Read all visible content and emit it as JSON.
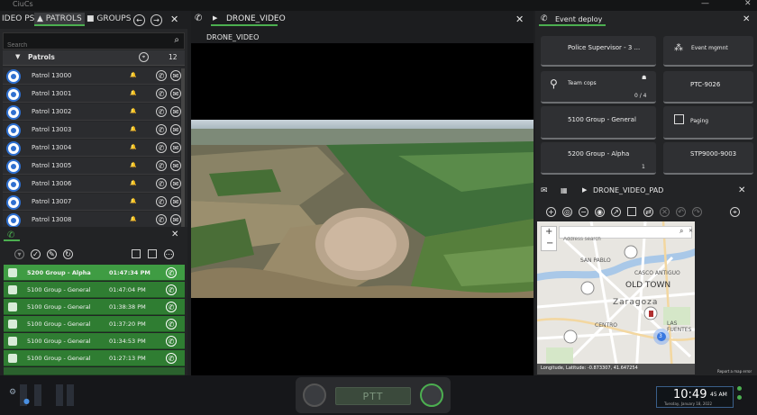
{
  "title_bar": {
    "app_name": "CiuCs"
  },
  "left_panel": {
    "tabs": [
      {
        "label": "IDEO PS"
      },
      {
        "label": "PATROLS"
      },
      {
        "label": "GROUPS"
      }
    ],
    "search_placeholder": "Search",
    "group": {
      "name": "Patrols",
      "count": "12"
    },
    "patrols": [
      {
        "name": "Patrol 13000"
      },
      {
        "name": "Patrol 13001"
      },
      {
        "name": "Patrol 13002"
      },
      {
        "name": "Patrol 13003"
      },
      {
        "name": "Patrol 13004"
      },
      {
        "name": "Patrol 13005"
      },
      {
        "name": "Patrol 13006"
      },
      {
        "name": "Patrol 13007"
      },
      {
        "name": "Patrol 13008"
      }
    ]
  },
  "call_history": {
    "rows": [
      {
        "group": "5200 Group - Alpha",
        "time": "01:47:34 PM"
      },
      {
        "group": "5100 Group - General",
        "time": "01:47:04 PM"
      },
      {
        "group": "5100 Group - General",
        "time": "01:38:38 PM"
      },
      {
        "group": "5100 Group - General",
        "time": "01:37:20 PM"
      },
      {
        "group": "5100 Group - General",
        "time": "01:34:53 PM"
      },
      {
        "group": "5100 Group - General",
        "time": "01:27:13 PM"
      }
    ]
  },
  "center": {
    "tab_label": "DRONE_VIDEO",
    "video_title": "DRONE_VIDEO"
  },
  "right_panel": {
    "title": "Event deploy",
    "cards": [
      {
        "label": "Police Supervisor - 3 ..."
      },
      {
        "label": "Event mgmnt"
      },
      {
        "label": "Team cops",
        "count": "0 / 4"
      },
      {
        "label": "PTC-9026"
      },
      {
        "label": "5100 Group - General"
      },
      {
        "label": "Paging"
      },
      {
        "label": "5200 Group - Alpha",
        "count": "1"
      },
      {
        "label": "STP9000-9003"
      }
    ],
    "map_tab_label": "DRONE_VIDEO_PAD",
    "map": {
      "search_placeholder": "Address search",
      "labels": [
        "SAN PABLO",
        "CASCO ANTIGUO",
        "OLD TOWN",
        "Zaragoza",
        "CENTRO",
        "LAS FUENTES"
      ],
      "cluster_count": "3",
      "coords_text": "Longitude, Latitude: -0.873307, 41.647254",
      "report_link": "Report a map error"
    }
  },
  "bottom": {
    "ptt_label": "PTT",
    "time": "10:49",
    "ampm": "45 AM",
    "date": "Tuesday, January 18, 2022",
    "accent_color": "#4caf50",
    "brand_color": "#2d6fd0"
  }
}
